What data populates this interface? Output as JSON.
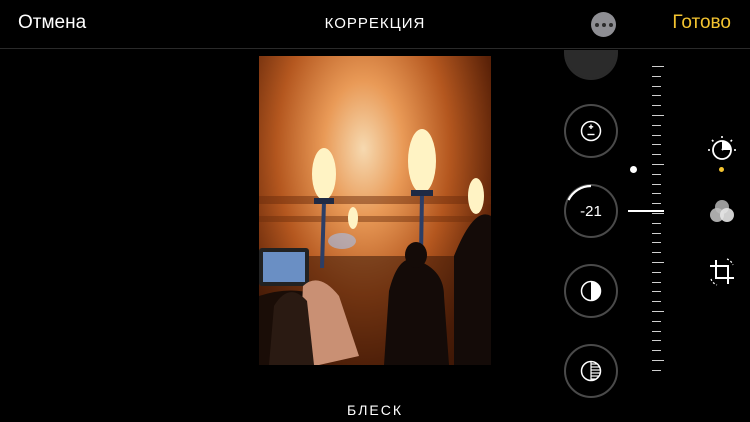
{
  "header": {
    "cancel_label": "Отмена",
    "title": "КОРРЕКЦИЯ",
    "more_icon": "ellipsis-icon",
    "done_label": "Готово"
  },
  "adjustment": {
    "active_label": "БЛЕСК",
    "active_value": "-21",
    "active_value_fraction": 0.21,
    "dials": [
      {
        "name": "previous-partial",
        "icon": "partial-dial"
      },
      {
        "name": "exposure",
        "icon": "plus-minus-icon"
      },
      {
        "name": "brilliance",
        "icon": "brilliance-icon"
      },
      {
        "name": "highlights",
        "icon": "half-circle-icon"
      },
      {
        "name": "shadows",
        "icon": "striped-half-circle-icon"
      }
    ]
  },
  "tools": [
    {
      "name": "adjust",
      "icon": "adjust-dial-icon",
      "active": true
    },
    {
      "name": "filters",
      "icon": "filters-icon",
      "active": false
    },
    {
      "name": "crop",
      "icon": "crop-rotate-icon",
      "active": false
    }
  ],
  "colors": {
    "accent": "#f4c430",
    "background": "#000000",
    "dial_border": "#4a4a4a"
  }
}
